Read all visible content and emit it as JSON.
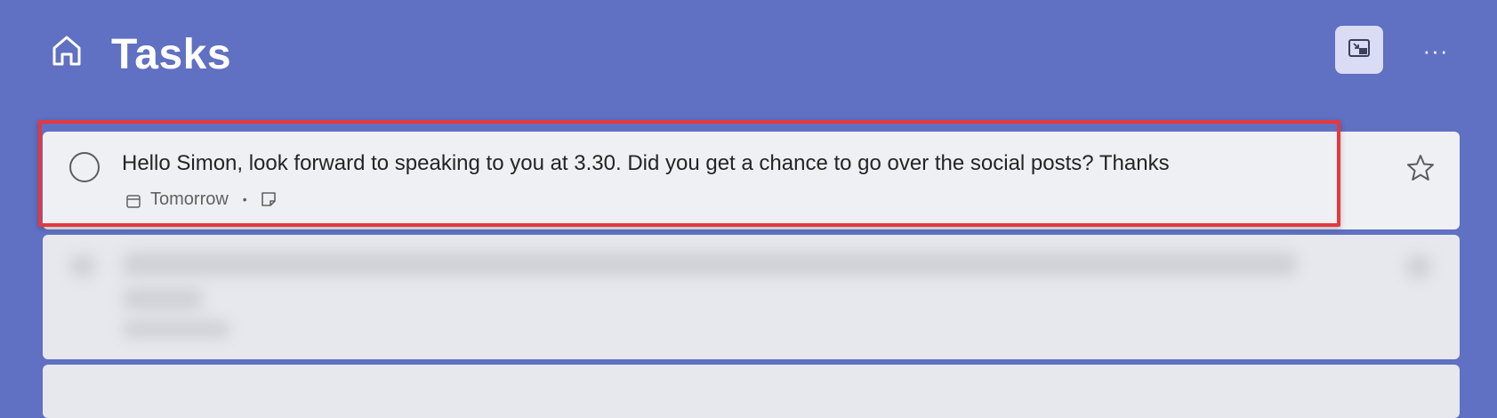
{
  "header": {
    "title": "Tasks",
    "home_icon": "home-icon",
    "focus_icon": "picture-in-picture-icon",
    "more_icon": "more-horizontal-icon",
    "more_label": "···"
  },
  "task": {
    "title": "Hello Simon, look forward to speaking to you at 3.30. Did you get a chance to go over the social posts? Thanks",
    "due": "Tomorrow",
    "separator": "•",
    "due_icon": "calendar-icon",
    "note_icon": "note-icon",
    "star_icon": "star-icon",
    "highlight_color": "#e5383f"
  },
  "colors": {
    "background": "#6070c2",
    "card": "#eff0f4",
    "accent_button": "#d9dcf2"
  }
}
